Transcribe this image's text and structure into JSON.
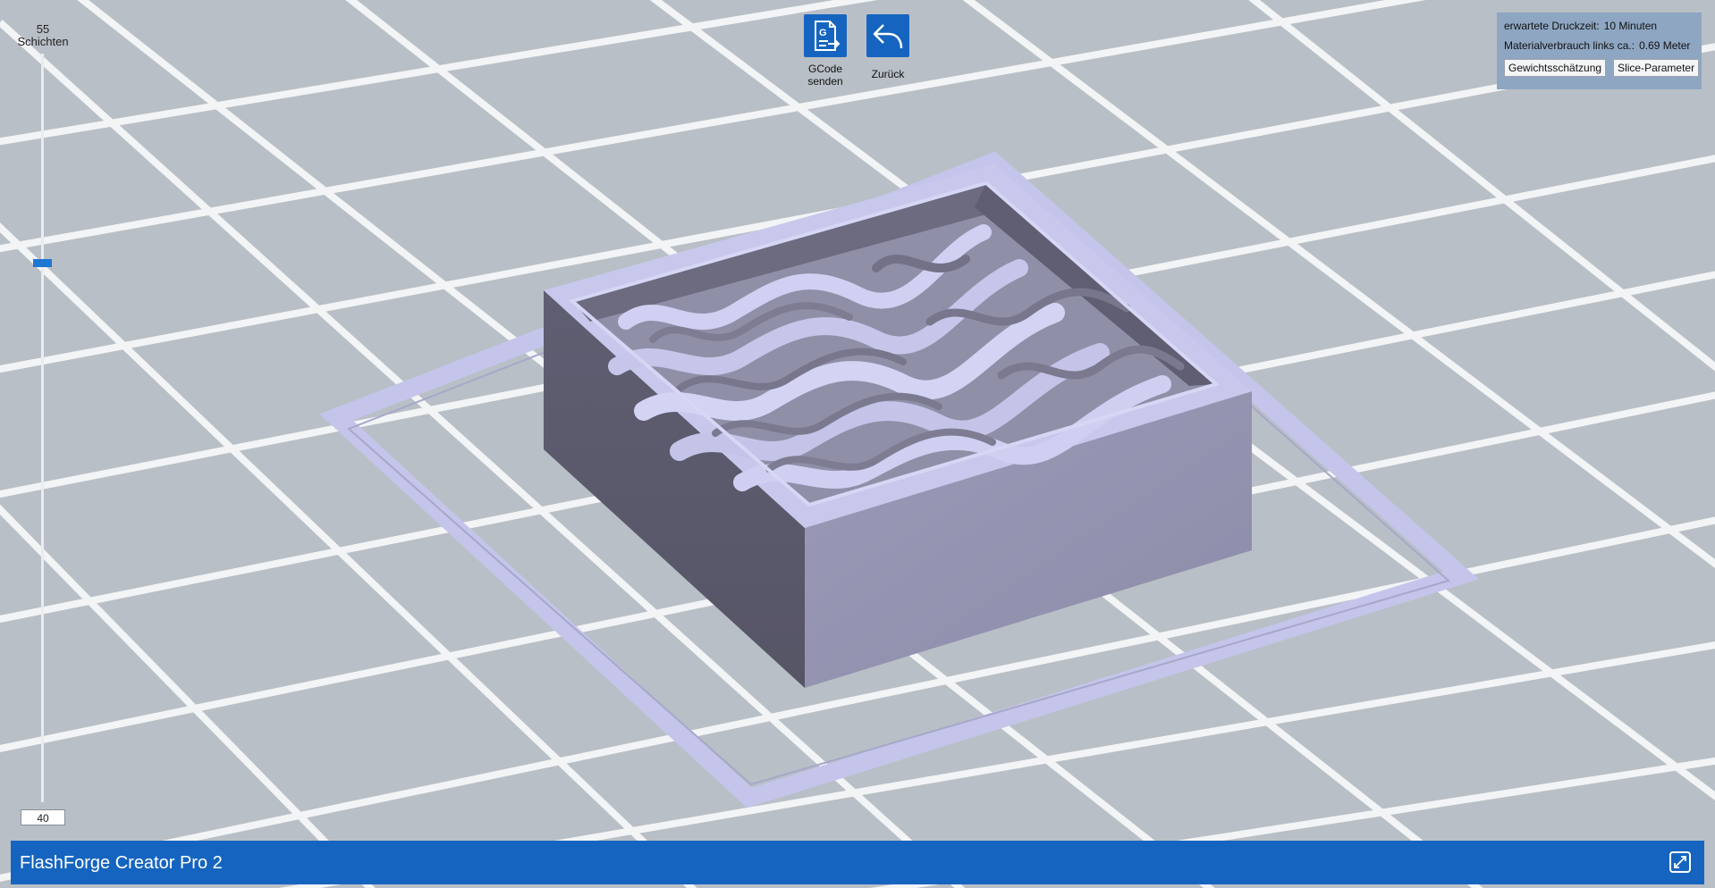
{
  "slider": {
    "layer_count": "55",
    "layer_unit": "Schichten",
    "current_layer": "40",
    "thumb_fraction": 0.28
  },
  "toolbar": {
    "gcode_label_line1": "GCode",
    "gcode_label_line2": "senden",
    "back_label": "Zurück"
  },
  "info": {
    "print_time_label": "erwartete Druckzeit:",
    "print_time_value": "10 Minuten",
    "material_label": "Materialverbrauch links ca.:",
    "material_value": "0.69 Meter",
    "weight_button": "Gewichtsschätzung",
    "slice_button": "Slice-Parameter"
  },
  "status_bar": {
    "printer_name": "FlashForge Creator Pro 2"
  },
  "colors": {
    "background": "#b9bfc6",
    "grid": "#f2f4f6",
    "accent": "#1565c0",
    "model_light": "#c8c8ec",
    "model_dark": "#5b5a6b",
    "model_front": "#9494b4"
  },
  "icons": {
    "gcode": "gcode-send-icon",
    "back": "undo-arrow-icon",
    "expand": "expand-icon"
  }
}
